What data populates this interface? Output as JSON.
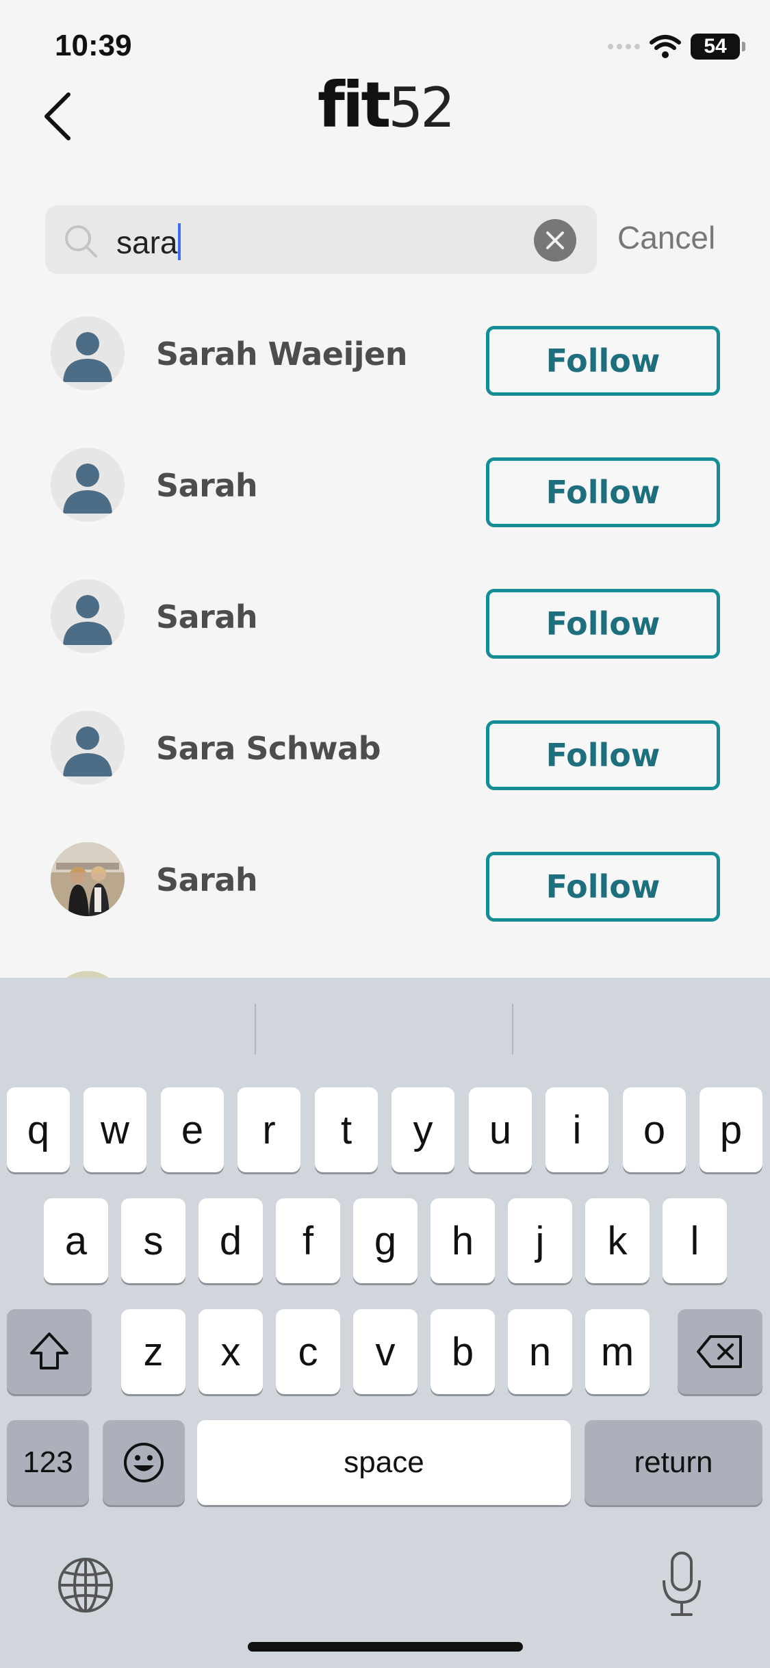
{
  "status_bar": {
    "time": "10:39",
    "battery": "54"
  },
  "header": {
    "logo_word": "fit",
    "logo_number": "52"
  },
  "search": {
    "value": "sara",
    "cancel_label": "Cancel"
  },
  "results": [
    {
      "name": "Sarah Waeijen",
      "follow_label": "Follow",
      "avatar": "placeholder-person-icon"
    },
    {
      "name": "Sarah",
      "follow_label": "Follow",
      "avatar": "placeholder-person-icon"
    },
    {
      "name": "Sarah",
      "follow_label": "Follow",
      "avatar": "placeholder-person-icon"
    },
    {
      "name": "Sara Schwab",
      "follow_label": "Follow",
      "avatar": "placeholder-person-icon"
    },
    {
      "name": "Sarah",
      "follow_label": "Follow",
      "avatar": "photo"
    }
  ],
  "keyboard": {
    "row1": [
      "q",
      "w",
      "e",
      "r",
      "t",
      "y",
      "u",
      "i",
      "o",
      "p"
    ],
    "row2": [
      "a",
      "s",
      "d",
      "f",
      "g",
      "h",
      "j",
      "k",
      "l"
    ],
    "row3": [
      "z",
      "x",
      "c",
      "v",
      "b",
      "n",
      "m"
    ],
    "numbers_label": "123",
    "space_label": "space",
    "return_label": "return"
  },
  "colors": {
    "accent": "#148c96",
    "avatar_figure": "#4d6d87",
    "caret": "#3b6ef0"
  }
}
